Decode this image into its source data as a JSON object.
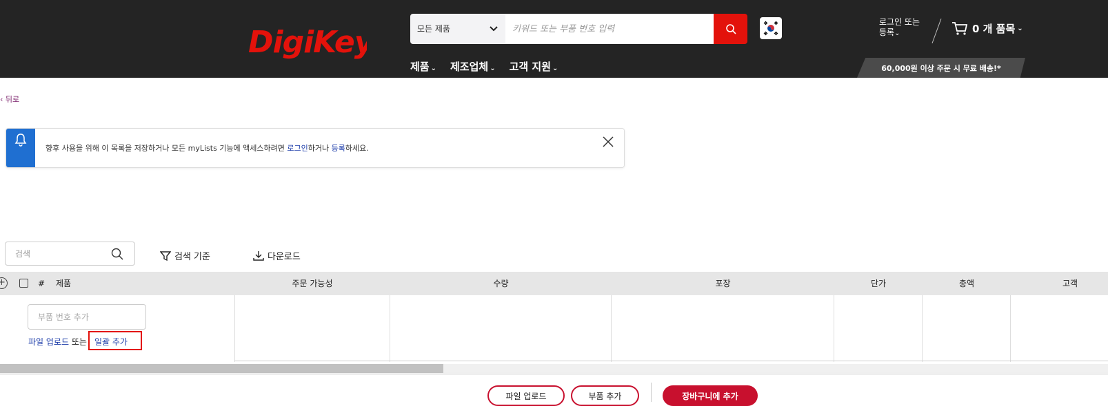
{
  "header": {
    "logo_text": "DigiKey",
    "search_category": "모든 제품",
    "search_placeholder": "키워드 또는 부품 번호 입력",
    "nav": [
      "제품",
      "제조업체",
      "고객 지원"
    ],
    "login_line1": "로그인 또는",
    "login_line2": "등록",
    "cart_label": "0 개 품목",
    "free_shipping": "60,000원 이상 주문 시 무료 배송!*"
  },
  "back_label": "뒤로",
  "notice": {
    "text_before": "향후 사용을 위해 이 목록을 저장하거나 모든 myLists 기능에 액세스하려면 ",
    "login_link": "로그인",
    "text_middle": "하거나 ",
    "register_link": "등록",
    "text_after": "하세요."
  },
  "toolbar": {
    "search_placeholder": "검색",
    "filter_label": "검색 기준",
    "download_label": "다운로드"
  },
  "table": {
    "columns": {
      "num": "#",
      "product": "제품",
      "availability": "주문 가능성",
      "quantity": "수량",
      "packaging": "포장",
      "unit_price": "단가",
      "total": "총액",
      "customer": "고객"
    },
    "part_input_placeholder": "부품 번호 추가",
    "upload_link": "파일 업로드",
    "or_text": "또는",
    "bulk_add_link": "일괄 추가"
  },
  "bottom_buttons": [
    "파일 업로드",
    "부품 추가",
    "장바구니에 추가"
  ],
  "colors": {
    "header_bg": "#242424",
    "brand_red": "#e3120b",
    "notice_blue": "#1f6fd1",
    "link_blue": "#1a3aa8"
  }
}
